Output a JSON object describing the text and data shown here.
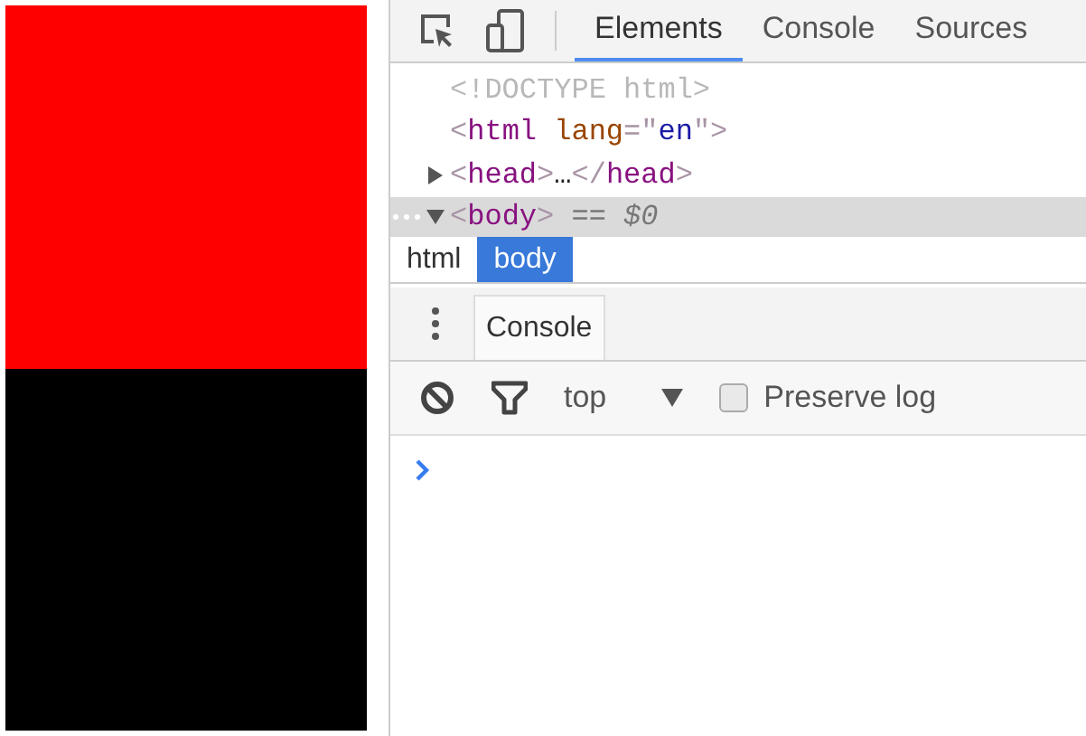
{
  "preview": {
    "blocks": [
      {
        "color": "#ff0000"
      },
      {
        "color": "#000000"
      }
    ]
  },
  "devtools": {
    "tabs": [
      {
        "label": "Elements",
        "selected": true
      },
      {
        "label": "Console",
        "selected": false
      },
      {
        "label": "Sources",
        "selected": false
      }
    ],
    "dom_tree": [
      {
        "selected": false,
        "tokens": [
          {
            "kind": "doctype",
            "text": "<!DOCTYPE html>"
          }
        ]
      },
      {
        "selected": false,
        "tokens": [
          {
            "kind": "bracket",
            "text": "<"
          },
          {
            "kind": "tag",
            "text": "html "
          },
          {
            "kind": "attr",
            "text": "lang"
          },
          {
            "kind": "bracket",
            "text": "=\""
          },
          {
            "kind": "value",
            "text": "en"
          },
          {
            "kind": "bracket",
            "text": "\">"
          }
        ]
      },
      {
        "expanded": false,
        "selected": false,
        "tokens": [
          {
            "kind": "bracket",
            "text": "<"
          },
          {
            "kind": "tag",
            "text": "head"
          },
          {
            "kind": "bracket",
            "text": ">"
          },
          {
            "kind": "plain",
            "text": "…"
          },
          {
            "kind": "bracket",
            "text": "</"
          },
          {
            "kind": "tag",
            "text": "head"
          },
          {
            "kind": "bracket",
            "text": ">"
          }
        ]
      },
      {
        "expanded": true,
        "selected": true,
        "tokens": [
          {
            "kind": "bracket",
            "text": "<"
          },
          {
            "kind": "tag",
            "text": "body"
          },
          {
            "kind": "bracket",
            "text": ">"
          },
          {
            "kind": "hint",
            "text": " == $0"
          }
        ]
      }
    ],
    "breadcrumbs": [
      {
        "label": "html",
        "selected": false
      },
      {
        "label": "body",
        "selected": true
      }
    ],
    "drawer_tabs": [
      {
        "label": "Console",
        "selected": true
      }
    ],
    "console_toolbar": {
      "context": "top",
      "preserve_log": {
        "label": "Preserve log",
        "checked": false
      }
    }
  }
}
